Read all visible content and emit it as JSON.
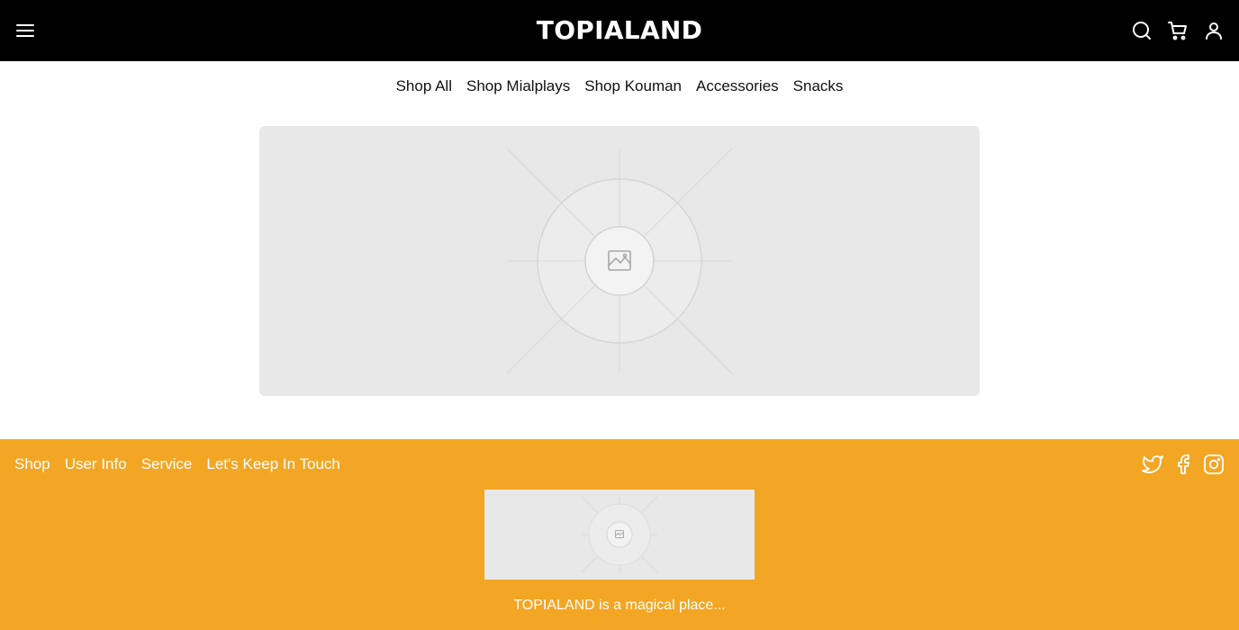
{
  "header": {
    "brand": "TOPIALAND",
    "icons": [
      "menu-icon",
      "search-icon",
      "cart-icon",
      "user-icon"
    ]
  },
  "category_nav": {
    "items": [
      {
        "label": "Shop All"
      },
      {
        "label": "Shop Mialplays"
      },
      {
        "label": "Shop Kouman"
      },
      {
        "label": "Accessories"
      },
      {
        "label": "Snacks"
      }
    ]
  },
  "hero": {
    "image": "image-placeholder-icon"
  },
  "footer": {
    "links": [
      {
        "label": "Shop"
      },
      {
        "label": "User Info"
      },
      {
        "label": "Service"
      },
      {
        "label": "Let's Keep In Touch"
      }
    ],
    "social_icons": [
      "twitter-icon",
      "facebook-icon",
      "instagram-icon"
    ],
    "logo_image": "image-placeholder-icon",
    "tagline": "TOPIALAND is a magical place..."
  },
  "colors": {
    "header_bg": "#000000",
    "footer_bg": "#f3a624",
    "placeholder_bg": "#e8e8e8"
  }
}
